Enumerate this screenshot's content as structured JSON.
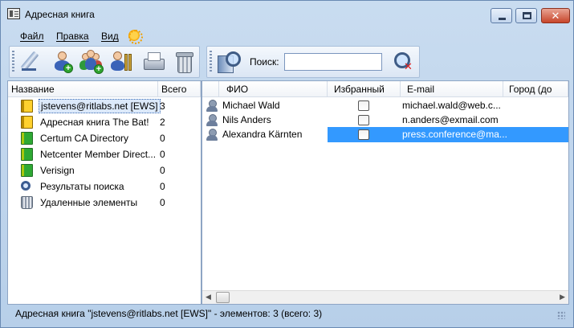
{
  "window": {
    "title": "Адресная книга"
  },
  "menu": {
    "file": "Файл",
    "edit": "Правка",
    "view": "Вид"
  },
  "toolbar": {
    "search_label": "Поиск:",
    "search_value": ""
  },
  "tree": {
    "columns": {
      "name": "Название",
      "total": "Всего"
    },
    "items": [
      {
        "name": "jstevens@ritlabs.net [EWS]",
        "count": "3",
        "icon": "book-yellow-icon",
        "selected": true
      },
      {
        "name": "Адресная книга The Bat!",
        "count": "2",
        "icon": "book-yellow-icon"
      },
      {
        "name": "Certum CA Directory",
        "count": "0",
        "icon": "ldap-book-green-icon"
      },
      {
        "name": "Netcenter Member Direct...",
        "count": "0",
        "icon": "ldap-book-green-icon"
      },
      {
        "name": "Verisign",
        "count": "0",
        "icon": "ldap-book-green-icon"
      },
      {
        "name": "Результаты поиска",
        "count": "0",
        "icon": "search-results-icon"
      },
      {
        "name": "Удаленные элементы",
        "count": "0",
        "icon": "trash-icon"
      }
    ]
  },
  "contacts": {
    "columns": {
      "name": "ФИО",
      "favorite": "Избранный",
      "email": "E-mail",
      "city": "Город (до"
    },
    "rows": [
      {
        "name": "Michael Wald",
        "favorite": false,
        "email": "michael.wald@web.c..."
      },
      {
        "name": "Nils Anders",
        "favorite": false,
        "email": "n.anders@exmail.com"
      },
      {
        "name": "Alexandra Kärnten",
        "favorite": false,
        "email": "press.conference@ma...",
        "selected": true
      }
    ]
  },
  "status": {
    "text": "Адресная книга \"jstevens@ritlabs.net [EWS]\" - элементов: 3 (всего: 3)"
  },
  "colors": {
    "selection": "#3399ff",
    "chrome": "#c9dcf0"
  }
}
